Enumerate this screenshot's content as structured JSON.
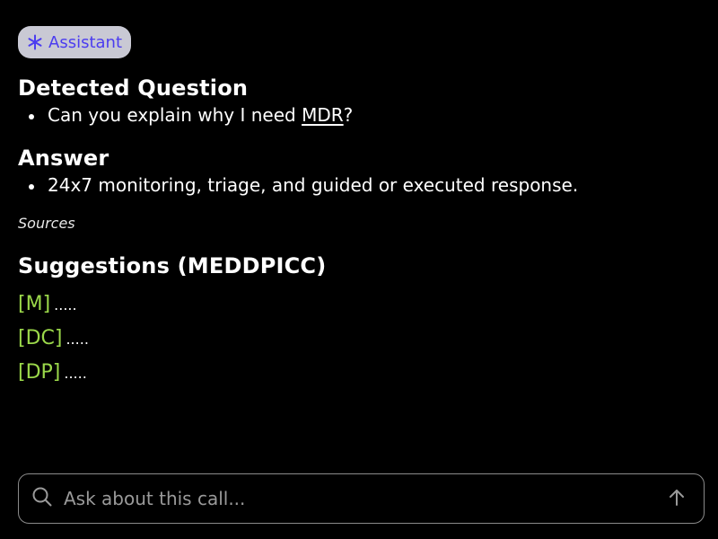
{
  "badge": {
    "label": "Assistant",
    "icon": "asterisk-icon"
  },
  "detected_question": {
    "heading": "Detected Question",
    "items": [
      {
        "before": "Can you explain why I need ",
        "link": "MDR",
        "after": "?"
      }
    ]
  },
  "answer": {
    "heading": "Answer",
    "items": [
      "24x7 monitoring, triage, and guided or executed response."
    ]
  },
  "sources_label": "Sources",
  "suggestions": {
    "heading": "Suggestions (MEDDPICC)",
    "items": [
      {
        "tag": "[M]",
        "text": "....."
      },
      {
        "tag": "[DC]",
        "text": "....."
      },
      {
        "tag": "[DP]",
        "text": "....."
      }
    ]
  },
  "ask": {
    "placeholder": "Ask about this call...",
    "search_icon": "search-icon",
    "send_icon": "arrow-up-icon"
  },
  "colors": {
    "background": "#000000",
    "badge_bg": "#c9c9d4",
    "badge_text": "#4b3cf0",
    "tag_green": "#9bd84a"
  }
}
